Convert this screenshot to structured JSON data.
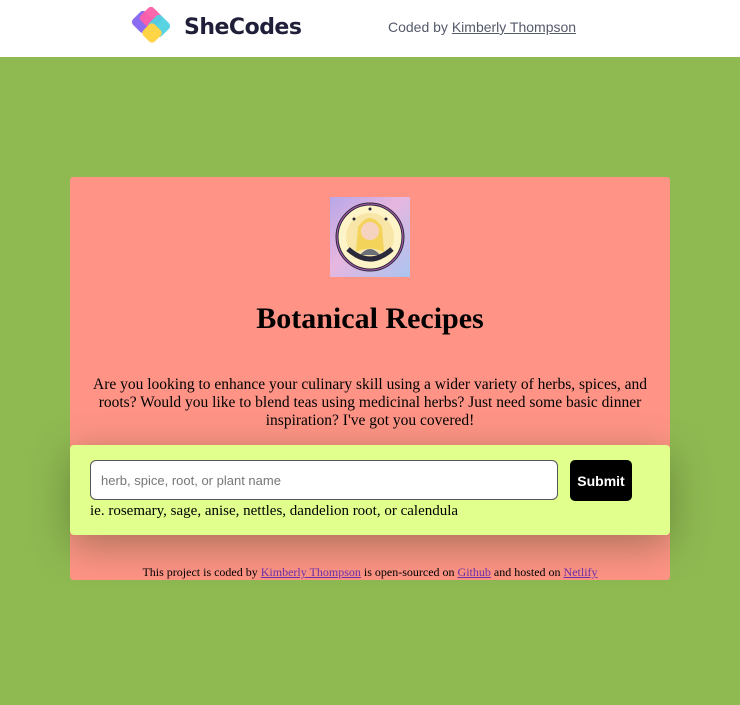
{
  "header": {
    "brand": "SheCodes",
    "credit_prefix": "Coded by ",
    "credit_name": "Kimberly Thompson"
  },
  "colors": {
    "page_background": "#8fba52",
    "card_background": "#ff9486",
    "search_background": "#e1ff8c",
    "button_background": "#000000",
    "link_color": "#6b2fa8"
  },
  "main": {
    "avatar_alt": "LIFE IS MAGICAL",
    "title": "Botanical Recipes",
    "intro": "Are you looking to enhance your culinary skill using a wider variety of herbs, spices, and roots? Would you like to blend teas using medicinal herbs? Just need some basic dinner inspiration? I've got you covered!"
  },
  "search": {
    "placeholder": "herb, spice, root, or plant name",
    "value": "",
    "submit_label": "Submit",
    "hint": "ie. rosemary, sage, anise, nettles, dandelion root, or calendula"
  },
  "footer": {
    "text1": "This project is coded by ",
    "author": "Kimberly Thompson",
    "text2": " is open-sourced on ",
    "github": "Github",
    "text3": " and hosted on ",
    "netlify": "Netlify"
  }
}
